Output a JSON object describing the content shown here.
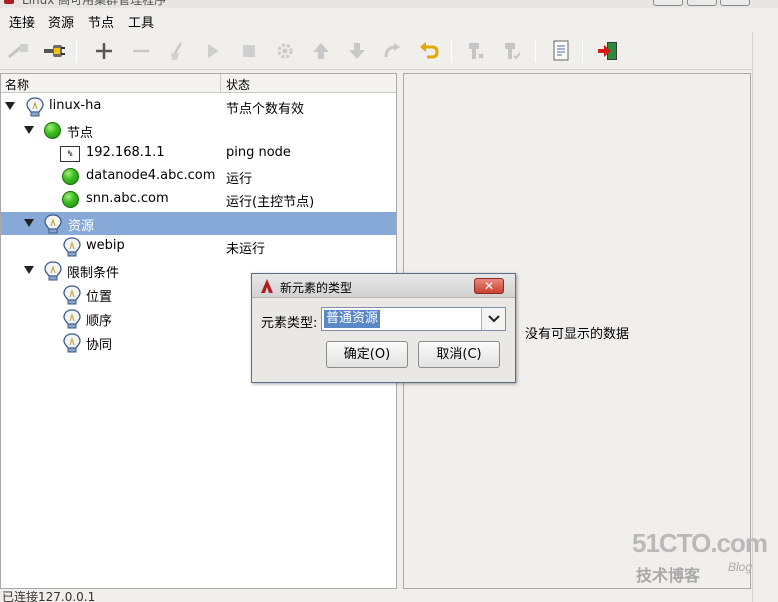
{
  "window": {
    "title": "Linux 高可用集群管理程序"
  },
  "menu": [
    "连接",
    "资源",
    "节点",
    "工具"
  ],
  "toolbar": {
    "buttons": [
      "disconnect-icon",
      "connect-icon",
      "add-icon",
      "remove-icon",
      "cleanup-icon",
      "start-icon",
      "stop-icon",
      "settings-icon",
      "move-up-icon",
      "move-down-icon",
      "migrate-icon",
      "undo-icon",
      "standby-icon",
      "active-icon",
      "log-icon",
      "exit-icon"
    ]
  },
  "tree": {
    "headers": {
      "name": "名称",
      "status": "状态"
    },
    "rows": [
      {
        "label": "linux-ha",
        "status": "节点个数有效",
        "icon": "bulb-icon",
        "expanded": true
      },
      {
        "label": "节点",
        "status": "",
        "icon": "green-status-icon",
        "expanded": true
      },
      {
        "label": "192.168.1.1",
        "status": "ping node",
        "icon": "ping-node-icon"
      },
      {
        "label": "datanode4.abc.com",
        "status": "运行",
        "icon": "green-status-icon"
      },
      {
        "label": "snn.abc.com",
        "status": "运行(主控节点)",
        "icon": "green-status-icon"
      },
      {
        "label": "资源",
        "status": "",
        "icon": "bulb-icon",
        "expanded": true,
        "selected": true
      },
      {
        "label": "webip",
        "status": "未运行",
        "icon": "bulb-icon"
      },
      {
        "label": "限制条件",
        "status": "",
        "icon": "bulb-icon",
        "expanded": true
      },
      {
        "label": "位置",
        "status": "",
        "icon": "bulb-icon"
      },
      {
        "label": "顺序",
        "status": "",
        "icon": "bulb-icon"
      },
      {
        "label": "协同",
        "status": "",
        "icon": "bulb-icon"
      }
    ]
  },
  "detail": {
    "empty_message": "没有可显示的数据"
  },
  "dialog": {
    "title": "新元素的类型",
    "close_label": "✕",
    "field_label": "元素类型:",
    "selected_value": "普通资源",
    "ok_label": "确定(O)",
    "cancel_label": "取消(C)"
  },
  "statusbar": {
    "text": "已连接127.0.0.1"
  },
  "watermark": {
    "brand": "51CTO.com",
    "sub": "技术博客",
    "blog": "Blog"
  },
  "colors": {
    "selection": "#87a9d8",
    "status_green": "#3cba1f",
    "dialog_close": "#c9402f"
  }
}
